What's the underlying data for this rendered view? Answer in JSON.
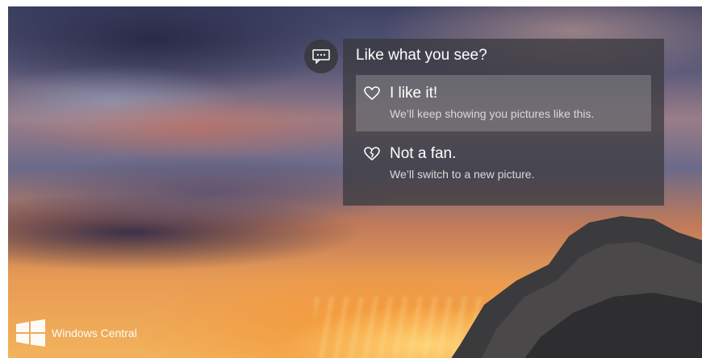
{
  "prompt": {
    "title": "Like what you see?",
    "icon": "chat-bubble-icon",
    "options": [
      {
        "icon": "heart-outline-icon",
        "title": "I like it!",
        "subtitle": "We’ll keep showing you pictures like this.",
        "selected": true
      },
      {
        "icon": "broken-heart-icon",
        "title": "Not a fan.",
        "subtitle": "We’ll switch to a new picture.",
        "selected": false
      }
    ]
  },
  "watermark": {
    "text": "Windows Central",
    "logo": "windows-logo"
  }
}
